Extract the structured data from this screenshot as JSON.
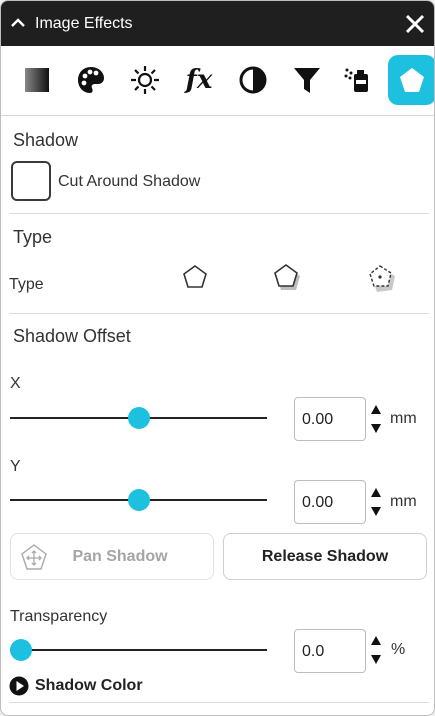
{
  "window": {
    "title": "Image Effects"
  },
  "toolbar": {
    "tools": [
      {
        "name": "gradient-icon",
        "label": ""
      },
      {
        "name": "palette-icon",
        "label": ""
      },
      {
        "name": "brightness-icon",
        "label": ""
      },
      {
        "name": "fx-icon",
        "label": "fx"
      },
      {
        "name": "contrast-icon",
        "label": ""
      },
      {
        "name": "filter-icon",
        "label": ""
      },
      {
        "name": "spray-icon",
        "label": ""
      },
      {
        "name": "shadow-pentagon-icon",
        "label": ""
      }
    ],
    "active": "shadow-pentagon-icon",
    "accent": "#1ec0df"
  },
  "shadow": {
    "heading": "Shadow",
    "cut_around_label": "Cut Around Shadow",
    "cut_around_checked": false
  },
  "type": {
    "heading": "Type",
    "label": "Type",
    "options": [
      "outline-pentagon-icon",
      "filled-shadow-pentagon-icon",
      "perspective-shadow-pentagon-icon"
    ]
  },
  "offset": {
    "heading": "Shadow Offset",
    "x": {
      "label": "X",
      "value": "0.00",
      "unit": "mm",
      "slider_fraction": 0.5
    },
    "y": {
      "label": "Y",
      "value": "0.00",
      "unit": "mm",
      "slider_fraction": 0.5
    }
  },
  "buttons": {
    "pan_shadow": "Pan Shadow",
    "release_shadow": "Release Shadow"
  },
  "transparency": {
    "label": "Transparency",
    "value": "0.0",
    "unit": "%",
    "slider_fraction": 0.0
  },
  "shadow_color": {
    "label": "Shadow Color"
  }
}
